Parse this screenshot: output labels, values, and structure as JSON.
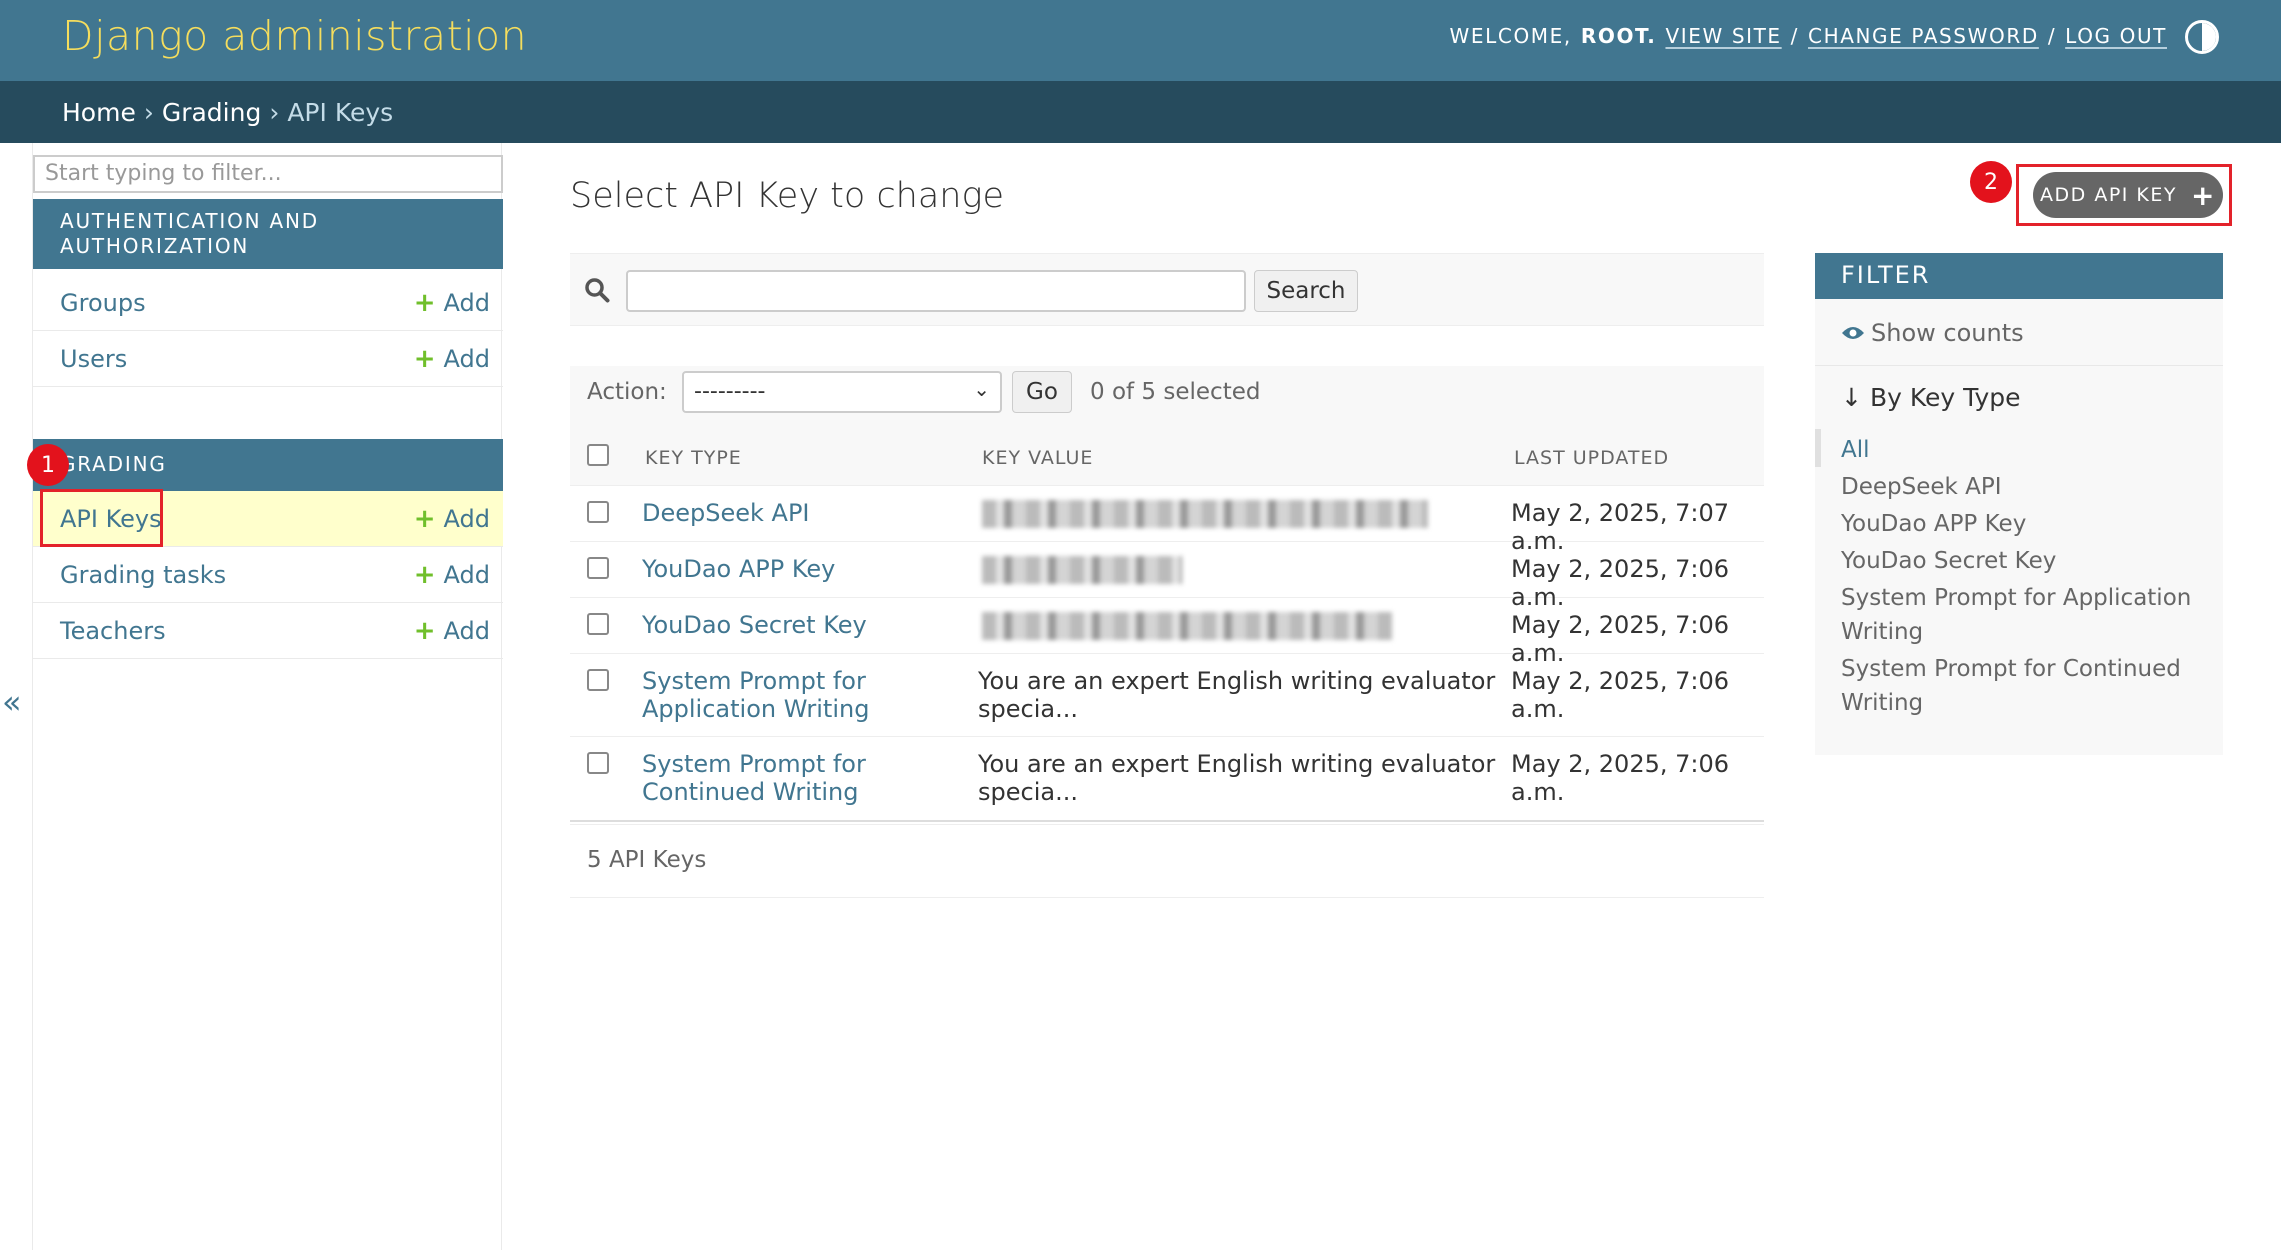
{
  "header": {
    "title": "Django administration",
    "welcome": "Welcome,",
    "username": "root",
    "view_site": "View site",
    "change_password": "Change password",
    "log_out": "Log out",
    "separator": "/"
  },
  "breadcrumbs": {
    "home": "Home",
    "app": "Grading",
    "current": "API Keys",
    "sep": "›"
  },
  "sidebar": {
    "filter_placeholder": "Start typing to filter...",
    "modules": [
      {
        "caption": "Authentication and Authorization",
        "models": [
          {
            "name": "Groups",
            "add": "Add"
          },
          {
            "name": "Users",
            "add": "Add"
          }
        ]
      },
      {
        "caption": "Grading",
        "models": [
          {
            "name": "API Keys",
            "add": "Add"
          },
          {
            "name": "Grading tasks",
            "add": "Add"
          },
          {
            "name": "Teachers",
            "add": "Add"
          }
        ]
      }
    ],
    "collapse": "«"
  },
  "annotations": {
    "badge_1": "1",
    "badge_2": "2"
  },
  "content": {
    "title": "Select API Key to change",
    "add_button": "Add API Key",
    "search_button": "Search",
    "action_label": "Action:",
    "action_value": "---------",
    "go_button": "Go",
    "selected_counter": "0 of 5 selected",
    "columns": [
      "Key type",
      "Key value",
      "Last updated"
    ],
    "rows": [
      {
        "key_type": "DeepSeek API",
        "key_value": "",
        "updated": "May 2, 2025, 7:07 a.m."
      },
      {
        "key_type": "YouDao APP Key",
        "key_value": "",
        "updated": "May 2, 2025, 7:06 a.m."
      },
      {
        "key_type": "YouDao Secret Key",
        "key_value": "",
        "updated": "May 2, 2025, 7:06 a.m."
      },
      {
        "key_type_1": "System Prompt for",
        "key_type_2": "Application Writing",
        "key_value_1": "You are an expert English writing evaluator",
        "key_value_2": "specia...",
        "updated": "May 2, 2025, 7:06 a.m."
      },
      {
        "key_type_1": "System Prompt for",
        "key_type_2": "Continued Writing",
        "key_value_1": "You are an expert English writing evaluator",
        "key_value_2": "specia...",
        "updated": "May 2, 2025, 7:06 a.m."
      }
    ],
    "paginator": "5 API Keys"
  },
  "filter": {
    "title": "Filter",
    "show_counts": "Show counts",
    "by_label": "By Key Type",
    "choices": [
      "All",
      "DeepSeek API",
      "YouDao APP Key",
      "YouDao Secret Key",
      "System Prompt for Application Writing",
      "System Prompt for Continued Writing"
    ]
  },
  "colors": {
    "header": "#417690",
    "breadcrumbs": "#264b5d",
    "brand": "#f5dd5d",
    "link": "#417690",
    "add_green": "#70bf2b",
    "highlight": "#e3222a"
  }
}
